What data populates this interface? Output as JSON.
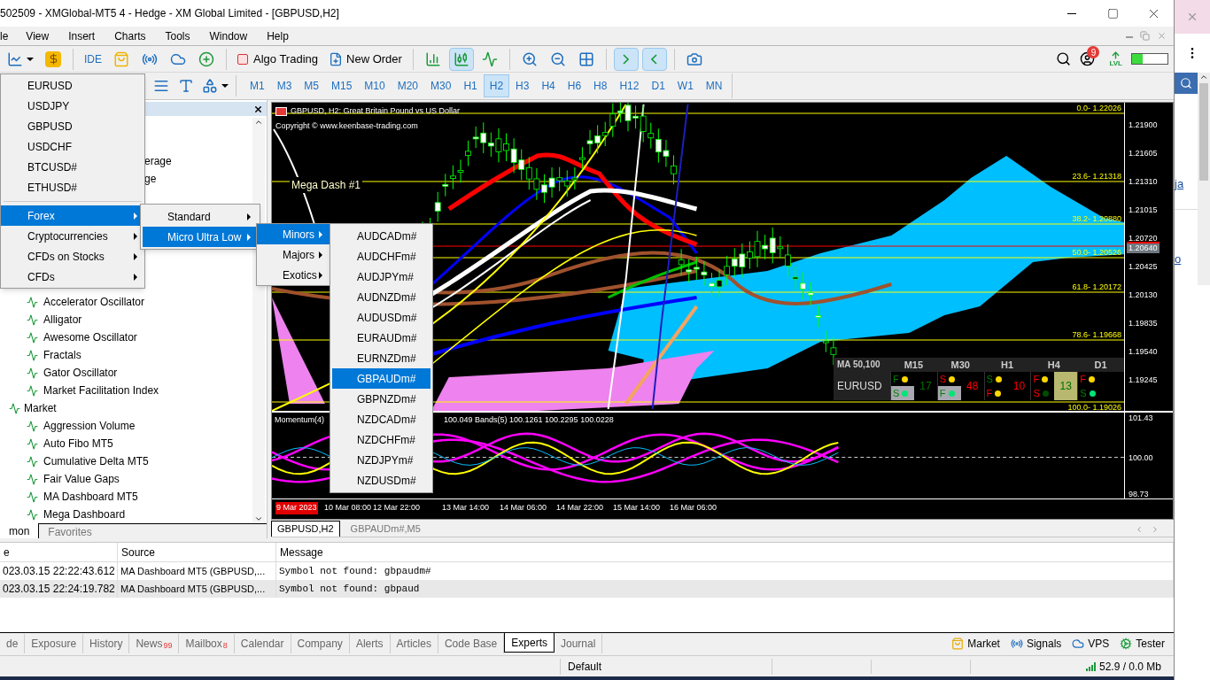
{
  "window": {
    "title": "502509 - XMGlobal-MT5 4 - Hedge - XM Global Limited - [GBPUSD,H2]"
  },
  "menu": [
    "le",
    "View",
    "Insert",
    "Charts",
    "Tools",
    "Window",
    "Help"
  ],
  "toolbar": {
    "ide": "IDE",
    "algo_trading": "Algo Trading",
    "new_order": "New Order",
    "notifications": "9",
    "lvl": "LVL",
    "level": 0.3
  },
  "timeframes": [
    {
      "label": "M1",
      "selected": false
    },
    {
      "label": "M3",
      "selected": false
    },
    {
      "label": "M5",
      "selected": false
    },
    {
      "label": "M15",
      "selected": false
    },
    {
      "label": "M10",
      "selected": false
    },
    {
      "label": "M20",
      "selected": false
    },
    {
      "label": "M30",
      "selected": false
    },
    {
      "label": "H1",
      "selected": false
    },
    {
      "label": "H2",
      "selected": true
    },
    {
      "label": "H3",
      "selected": false
    },
    {
      "label": "H4",
      "selected": false
    },
    {
      "label": "H6",
      "selected": false
    },
    {
      "label": "H8",
      "selected": false
    },
    {
      "label": "H12",
      "selected": false
    },
    {
      "label": "D1",
      "selected": false
    },
    {
      "label": "W1",
      "selected": false
    },
    {
      "label": "MN",
      "selected": false
    }
  ],
  "symbol_menu": {
    "symbols": [
      "EURUSD",
      "USDJPY",
      "GBPUSD",
      "USDCHF",
      "BTCUSD#",
      "ETHUSD#"
    ],
    "categories": [
      {
        "label": "Forex",
        "selected": true
      },
      {
        "label": "Cryptocurrencies",
        "selected": false
      },
      {
        "label": "CFDs on Stocks",
        "selected": false
      },
      {
        "label": "CFDs",
        "selected": false
      }
    ]
  },
  "forex_menu": [
    {
      "label": "Standard",
      "selected": false
    },
    {
      "label": "Micro Ultra Low",
      "selected": true
    }
  ],
  "micro_menu": [
    {
      "label": "Minors",
      "selected": true
    },
    {
      "label": "Majors",
      "selected": false
    },
    {
      "label": "Exotics",
      "selected": false
    }
  ],
  "minors_menu": [
    {
      "label": "AUDCADm#",
      "selected": false
    },
    {
      "label": "AUDCHFm#",
      "selected": false
    },
    {
      "label": "AUDJPYm#",
      "selected": false
    },
    {
      "label": "AUDNZDm#",
      "selected": false
    },
    {
      "label": "AUDUSDm#",
      "selected": false
    },
    {
      "label": "EURAUDm#",
      "selected": false
    },
    {
      "label": "EURNZDm#",
      "selected": false
    },
    {
      "label": "GBPAUDm#",
      "selected": true
    },
    {
      "label": "GBPNZDm#",
      "selected": false
    },
    {
      "label": "NZDCADm#",
      "selected": false
    },
    {
      "label": "NZDCHFm#",
      "selected": false
    },
    {
      "label": "NZDJPYm#",
      "selected": false
    },
    {
      "label": "NZDUSDm#",
      "selected": false
    }
  ],
  "navigator": {
    "fragments": [
      "erage",
      "ge"
    ],
    "tree": [
      {
        "children": [
          {
            "label": "Accelerator Oscillator"
          },
          {
            "label": "Alligator"
          },
          {
            "label": "Awesome Oscillator"
          },
          {
            "label": "Fractals"
          },
          {
            "label": "Gator Oscillator"
          },
          {
            "label": "Market Facilitation Index"
          }
        ]
      },
      {
        "label": "Market",
        "children": [
          {
            "label": "Aggression Volume"
          },
          {
            "label": "Auto Fibo MT5"
          },
          {
            "label": "Cumulative Delta MT5"
          },
          {
            "label": "Fair Value Gaps"
          },
          {
            "label": "MA Dashboard MT5"
          },
          {
            "label": "Mega Dashboard"
          }
        ]
      }
    ],
    "tabs": [
      {
        "label": "mon",
        "selected": true
      },
      {
        "label": "Favorites",
        "selected": false
      }
    ]
  },
  "chart": {
    "title": "GBPUSD, H2: Great Britain Pound vs US Dollar",
    "copyright": "Copyright © www.keenbase-trading.com",
    "indicator_label": "Mega Dash #1",
    "price_ticks": [
      "1.21900",
      "1.21605",
      "1.21310",
      "1.21015",
      "1.20720",
      "1.20425",
      "1.20130",
      "1.19835",
      "1.19540",
      "1.19245"
    ],
    "current_price": "1.20640",
    "fib_levels": [
      "0.0- 1.22026",
      "23.6- 1.21318",
      "38.2- 1.20880",
      "50.0- 1.20526",
      "61.8- 1.20172",
      "78.6- 1.19668",
      "100.0- 1.19026"
    ],
    "dashboard": {
      "title": "MA 50,100",
      "columns": [
        "M15",
        "M30",
        "H1",
        "H4",
        "D1"
      ],
      "symbol": "EURUSD",
      "cells": [
        {
          "top": "F",
          "top_up": true,
          "bottom": "S",
          "bottom_up": true,
          "color": "#00e676",
          "shaded": true,
          "count": "17",
          "count_up": true,
          "highlighted": false
        },
        {
          "top": "S",
          "top_up": false,
          "bottom": "F",
          "bottom_up": true,
          "color": "#00e676",
          "shaded": true,
          "count": "48",
          "count_up": false,
          "highlighted": false
        },
        {
          "top": "S",
          "top_up": true,
          "bottom": "F",
          "bottom_up": false,
          "color": "#ffd700",
          "shaded": false,
          "count": "10",
          "count_up": false,
          "highlighted": false
        },
        {
          "top": "F",
          "top_up": false,
          "bottom": "S",
          "bottom_up": false,
          "color": "#004d00",
          "shaded": false,
          "count": "13",
          "count_up": true,
          "highlighted": true
        },
        {
          "top": "F",
          "top_up": false,
          "bottom": "S",
          "bottom_up": true,
          "color": "#00e676",
          "shaded": false
        }
      ]
    },
    "momentum": {
      "title": "Momentum(4)",
      "values": "100.049 Bands(5) 100.1261 100.2295 100.0228",
      "ticks": [
        "101.43",
        "100.00",
        "98.73"
      ]
    },
    "time_labels": [
      {
        "label": "9 Mar 2023",
        "highlighted": true
      },
      {
        "label": "10 Mar 08:00",
        "highlighted": false
      },
      {
        "label": "12 Mar 22:00",
        "highlighted": false
      },
      {
        "label": "13 Mar 14:00",
        "highlighted": false
      },
      {
        "label": "14 Mar 06:00",
        "highlighted": false
      },
      {
        "label": "14 Mar 22:00",
        "highlighted": false
      },
      {
        "label": "15 Mar 14:00",
        "highlighted": false
      },
      {
        "label": "16 Mar 06:00",
        "highlighted": false
      }
    ]
  },
  "chart_tabs": [
    {
      "label": "GBPUSD,H2",
      "selected": true
    },
    {
      "label": "GBPAUDm#,M5",
      "selected": false
    }
  ],
  "toolbox": {
    "columns": [
      "e",
      "Source",
      "Message"
    ],
    "rows": [
      {
        "cells": [
          "023.03.15 22:22:43.612",
          "MA Dashboard MT5 (GBPUSD,...",
          "Symbol not found: gbpaudm#"
        ],
        "selected": false
      },
      {
        "cells": [
          "023.03.15 22:24:19.782",
          "MA Dashboard MT5 (GBPUSD,...",
          "Symbol not found: gbpaud"
        ],
        "selected": true
      }
    ]
  },
  "bottom_tabs": [
    {
      "label": "de",
      "selected": false
    },
    {
      "label": "Exposure",
      "selected": false
    },
    {
      "label": "History",
      "selected": false
    },
    {
      "label": "News",
      "count": "99",
      "selected": false
    },
    {
      "label": "Mailbox",
      "count": "8",
      "selected": false
    },
    {
      "label": "Calendar",
      "selected": false
    },
    {
      "label": "Company",
      "selected": false
    },
    {
      "label": "Alerts",
      "selected": false
    },
    {
      "label": "Articles",
      "selected": false
    },
    {
      "label": "Code Base",
      "selected": false
    },
    {
      "label": "Experts",
      "selected": true
    },
    {
      "label": "Journal",
      "selected": false
    }
  ],
  "side_buttons": [
    {
      "label": "Market",
      "kind": "market"
    },
    {
      "label": "Signals",
      "kind": "signals"
    },
    {
      "label": "VPS",
      "kind": "vps"
    },
    {
      "label": "Tester",
      "kind": "tester"
    }
  ],
  "status_bar": {
    "profile": "Default",
    "traffic": "52.9 / 0.0 Mb"
  },
  "browser_strip": {
    "links": [
      "ja",
      "o"
    ]
  }
}
